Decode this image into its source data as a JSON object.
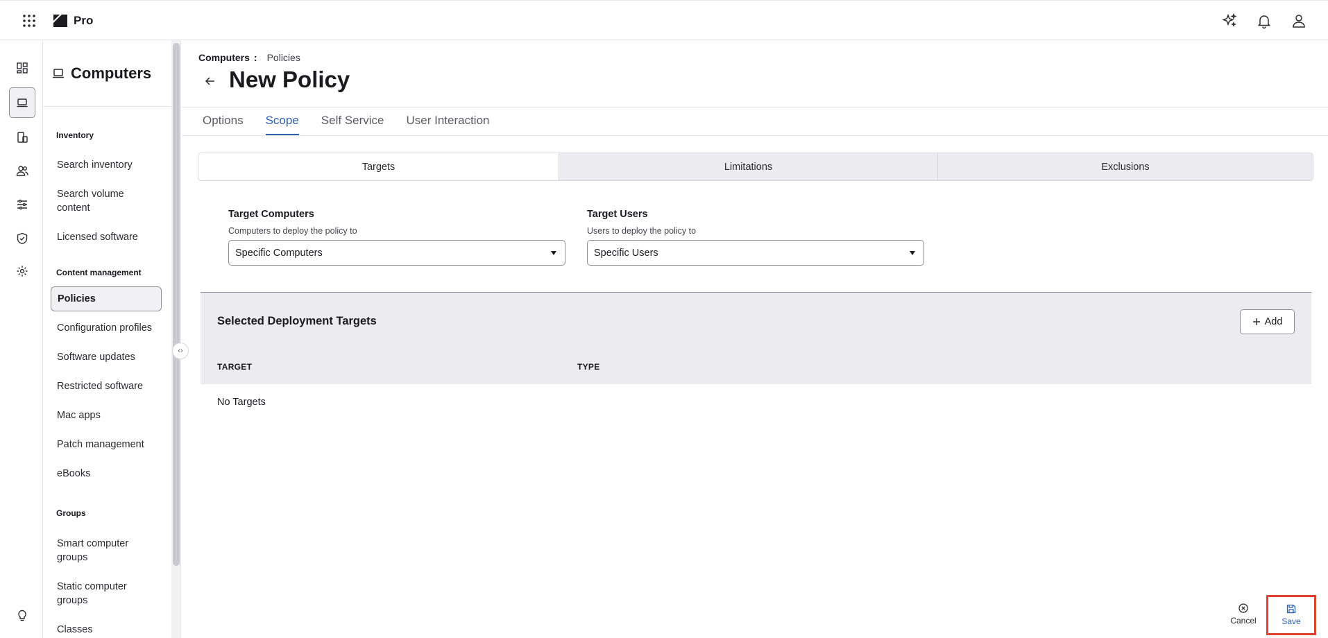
{
  "app": {
    "name": "Pro"
  },
  "sidebar": {
    "title": "Computers",
    "sections": [
      {
        "label": "Inventory"
      },
      {
        "label": "Content management"
      },
      {
        "label": "Groups"
      }
    ],
    "items": [
      {
        "label": "Search inventory"
      },
      {
        "label": "Search volume content"
      },
      {
        "label": "Licensed software"
      },
      {
        "label": "Policies"
      },
      {
        "label": "Configuration profiles"
      },
      {
        "label": "Software updates"
      },
      {
        "label": "Restricted software"
      },
      {
        "label": "Mac apps"
      },
      {
        "label": "Patch management"
      },
      {
        "label": "eBooks"
      },
      {
        "label": "Smart computer groups"
      },
      {
        "label": "Static computer groups"
      },
      {
        "label": "Classes"
      }
    ]
  },
  "breadcrumb": {
    "parent": "Computers",
    "separator": ":",
    "current": "Policies"
  },
  "page": {
    "title": "New Policy"
  },
  "tabs": [
    {
      "label": "Options"
    },
    {
      "label": "Scope"
    },
    {
      "label": "Self Service"
    },
    {
      "label": "User Interaction"
    }
  ],
  "scope_segments": [
    {
      "label": "Targets"
    },
    {
      "label": "Limitations"
    },
    {
      "label": "Exclusions"
    }
  ],
  "target_computers": {
    "label": "Target Computers",
    "hint": "Computers to deploy the policy to",
    "value": "Specific Computers"
  },
  "target_users": {
    "label": "Target Users",
    "hint": "Users to deploy the policy to",
    "value": "Specific Users"
  },
  "deployment": {
    "title": "Selected Deployment Targets",
    "add_label": "Add",
    "columns": [
      "TARGET",
      "TYPE"
    ],
    "empty_text": "No Targets"
  },
  "footer": {
    "cancel_label": "Cancel",
    "save_label": "Save"
  },
  "colors": {
    "accent": "#2f5fb3",
    "highlight": "#e0412f"
  }
}
